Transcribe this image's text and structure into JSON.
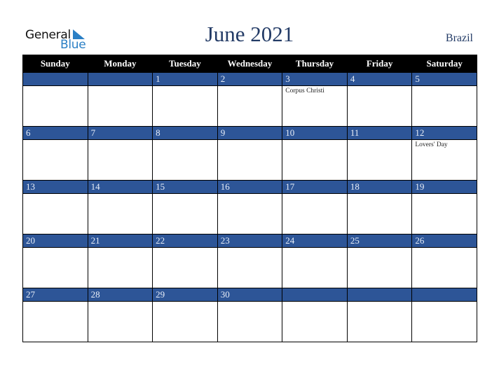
{
  "logo": {
    "word1": "General",
    "word2": "Blue"
  },
  "header": {
    "title": "June 2021",
    "country": "Brazil"
  },
  "colors": {
    "band": "#2d5597",
    "header_bg": "#000000",
    "title": "#233b66",
    "logo_blue": "#2a7fc5"
  },
  "weekdays": [
    "Sunday",
    "Monday",
    "Tuesday",
    "Wednesday",
    "Thursday",
    "Friday",
    "Saturday"
  ],
  "weeks": [
    [
      {
        "day": "",
        "holiday": ""
      },
      {
        "day": "",
        "holiday": ""
      },
      {
        "day": "1",
        "holiday": ""
      },
      {
        "day": "2",
        "holiday": ""
      },
      {
        "day": "3",
        "holiday": "Corpus Christi"
      },
      {
        "day": "4",
        "holiday": ""
      },
      {
        "day": "5",
        "holiday": ""
      }
    ],
    [
      {
        "day": "6",
        "holiday": ""
      },
      {
        "day": "7",
        "holiday": ""
      },
      {
        "day": "8",
        "holiday": ""
      },
      {
        "day": "9",
        "holiday": ""
      },
      {
        "day": "10",
        "holiday": ""
      },
      {
        "day": "11",
        "holiday": ""
      },
      {
        "day": "12",
        "holiday": "Lovers' Day"
      }
    ],
    [
      {
        "day": "13",
        "holiday": ""
      },
      {
        "day": "14",
        "holiday": ""
      },
      {
        "day": "15",
        "holiday": ""
      },
      {
        "day": "16",
        "holiday": ""
      },
      {
        "day": "17",
        "holiday": ""
      },
      {
        "day": "18",
        "holiday": ""
      },
      {
        "day": "19",
        "holiday": ""
      }
    ],
    [
      {
        "day": "20",
        "holiday": ""
      },
      {
        "day": "21",
        "holiday": ""
      },
      {
        "day": "22",
        "holiday": ""
      },
      {
        "day": "23",
        "holiday": ""
      },
      {
        "day": "24",
        "holiday": ""
      },
      {
        "day": "25",
        "holiday": ""
      },
      {
        "day": "26",
        "holiday": ""
      }
    ],
    [
      {
        "day": "27",
        "holiday": ""
      },
      {
        "day": "28",
        "holiday": ""
      },
      {
        "day": "29",
        "holiday": ""
      },
      {
        "day": "30",
        "holiday": ""
      },
      {
        "day": "",
        "holiday": ""
      },
      {
        "day": "",
        "holiday": ""
      },
      {
        "day": "",
        "holiday": ""
      }
    ]
  ]
}
